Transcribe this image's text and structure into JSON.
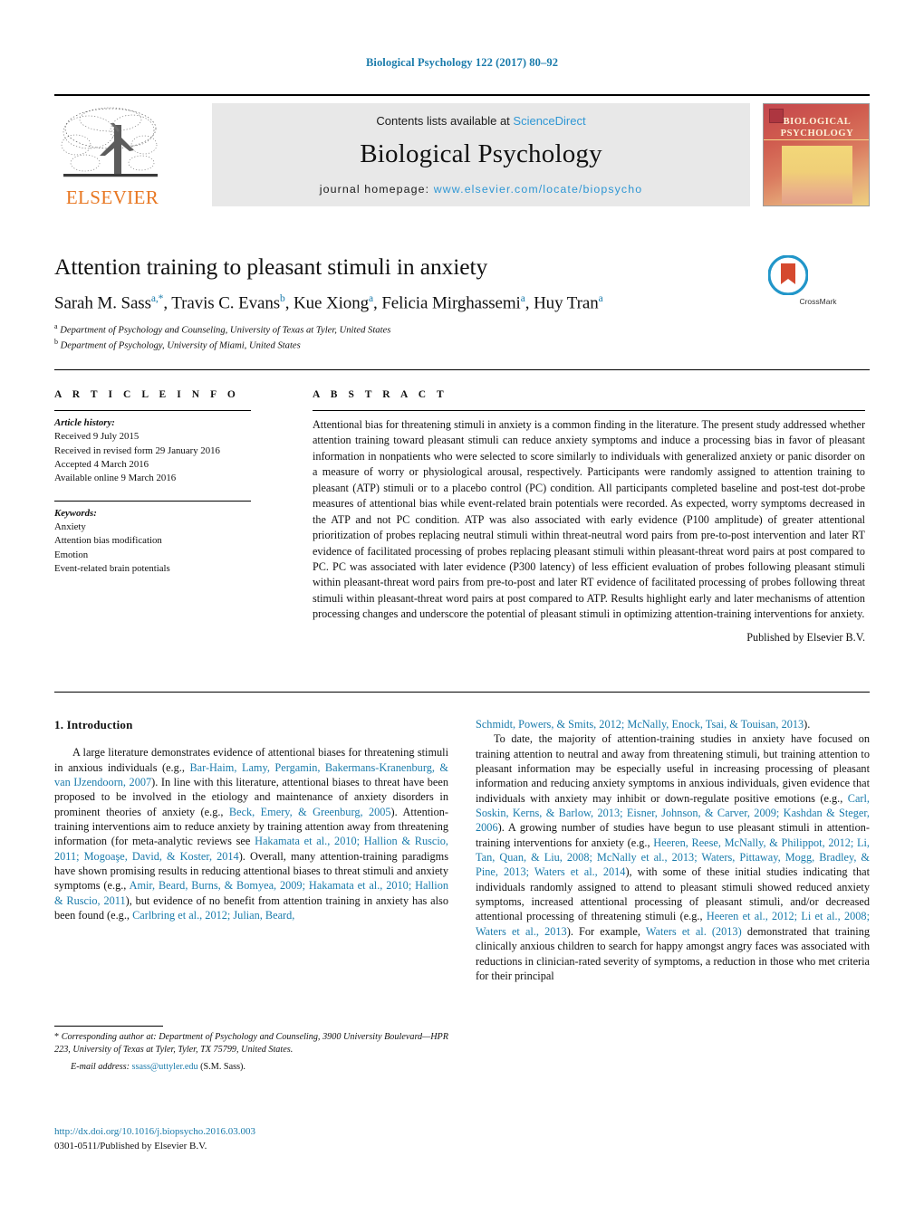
{
  "running_head": "Biological Psychology 122 (2017) 80–92",
  "masthead": {
    "elsevier_wordmark": "ELSEVIER",
    "contents_prefix": "Contents lists available at ",
    "contents_link": "ScienceDirect",
    "journal_title": "Biological Psychology",
    "homepage_prefix": "journal homepage: ",
    "homepage_url": "www.elsevier.com/locate/biopsycho",
    "cover_title_line1": "BIOLOGICAL",
    "cover_title_line2": "PSYCHOLOGY"
  },
  "article": {
    "title": "Attention training to pleasant stimuli in anxiety",
    "authors_html": "Sarah M. Sass<sup>a,*</sup>, Travis C. Evans<sup>b</sup>, Kue Xiong<sup>a</sup>, Felicia Mirghassemi<sup>a</sup>, Huy Tran<sup>a</sup>",
    "affiliation_a": "Department of Psychology and Counseling, University of Texas at Tyler, United States",
    "affiliation_b": "Department of Psychology, University of Miami, United States",
    "crossmark_label": "CrossMark"
  },
  "info": {
    "heading": "A R T I C L E   I N F O",
    "history_label": "Article history:",
    "history": [
      "Received 9 July 2015",
      "Received in revised form 29 January 2016",
      "Accepted 4 March 2016",
      "Available online 9 March 2016"
    ],
    "keywords_label": "Keywords:",
    "keywords": [
      "Anxiety",
      "Attention bias modification",
      "Emotion",
      "Event-related brain potentials"
    ]
  },
  "abstract": {
    "heading": "A B S T R A C T",
    "text": "Attentional bias for threatening stimuli in anxiety is a common finding in the literature. The present study addressed whether attention training toward pleasant stimuli can reduce anxiety symptoms and induce a processing bias in favor of pleasant information in nonpatients who were selected to score similarly to individuals with generalized anxiety or panic disorder on a measure of worry or physiological arousal, respectively. Participants were randomly assigned to attention training to pleasant (ATP) stimuli or to a placebo control (PC) condition. All participants completed baseline and post-test dot-probe measures of attentional bias while event-related brain potentials were recorded. As expected, worry symptoms decreased in the ATP and not PC condition. ATP was also associated with early evidence (P100 amplitude) of greater attentional prioritization of probes replacing neutral stimuli within threat-neutral word pairs from pre-to-post intervention and later RT evidence of facilitated processing of probes replacing pleasant stimuli within pleasant-threat word pairs at post compared to PC. PC was associated with later evidence (P300 latency) of less efficient evaluation of probes following pleasant stimuli within pleasant-threat word pairs from pre-to-post and later RT evidence of facilitated processing of probes following threat stimuli within pleasant-threat word pairs at post compared to ATP. Results highlight early and later mechanisms of attention processing changes and underscore the potential of pleasant stimuli in optimizing attention-training interventions for anxiety.",
    "publisher": "Published by Elsevier B.V."
  },
  "introduction": {
    "heading": "1. Introduction",
    "left_paragraph_html": "A large literature demonstrates evidence of attentional biases for threatening stimuli in anxious individuals (e.g., <span class=\"ref\">Bar-Haim, Lamy, Pergamin, Bakermans-Kranenburg, &amp; van IJzendoorn, 2007</span>). In line with this literature, attentional biases to threat have been proposed to be involved in the etiology and maintenance of anxiety disorders in prominent theories of anxiety (e.g., <span class=\"ref\">Beck, Emery, &amp; Greenburg, 2005</span>). Attention-training interventions aim to reduce anxiety by training attention away from threatening information (for meta-analytic reviews see <span class=\"ref\">Hakamata et al., 2010; Hallion &amp; Ruscio, 2011; Mogoa&#351;e, David, &amp; Koster, 2014</span>). Overall, many attention-training paradigms have shown promising results in reducing attentional biases to threat stimuli and anxiety symptoms (e.g., <span class=\"ref\">Amir, Beard, Burns, &amp; Bomyea, 2009; Hakamata et al., 2010; Hallion &amp; Ruscio, 2011</span>), but evidence of no benefit from attention training in anxiety has also been found (e.g., <span class=\"ref\">Carlbring et al., 2012; Julian, Beard,</span>",
    "right_continuation_html": "<span class=\"ref\">Schmidt, Powers, &amp; Smits, 2012; McNally, Enock, Tsai, &amp; Touisan, 2013</span>).",
    "right_paragraph_html": "To date, the majority of attention-training studies in anxiety have focused on training attention to neutral and away from threatening stimuli, but training attention to pleasant information may be especially useful in increasing processing of pleasant information and reducing anxiety symptoms in anxious individuals, given evidence that individuals with anxiety may inhibit or down-regulate positive emotions (e.g., <span class=\"ref\">Carl, Soskin, Kerns, &amp; Barlow, 2013; Eisner, Johnson, &amp; Carver, 2009; Kashdan &amp; Steger, 2006</span>). A growing number of studies have begun to use pleasant stimuli in attention-training interventions for anxiety (e.g., <span class=\"ref\">Heeren, Reese, McNally, &amp; Philippot, 2012; Li, Tan, Quan, &amp; Liu, 2008; McNally et al., 2013; Waters, Pittaway, Mogg, Bradley, &amp; Pine, 2013; Waters et al., 2014</span>), with some of these initial studies indicating that individuals randomly assigned to attend to pleasant stimuli showed reduced anxiety symptoms, increased attentional processing of pleasant stimuli, and/or decreased attentional processing of threatening stimuli (e.g., <span class=\"ref\">Heeren et al., 2012; Li et al., 2008; Waters et al., 2013</span>). For example, <span class=\"ref\">Waters et al. (2013)</span> demonstrated that training clinically anxious children to search for happy amongst angry faces was associated with reductions in clinician-rated severity of symptoms, a reduction in those who met criteria for their principal"
  },
  "footnote": {
    "corresponding_html": "* <span class=\"it\">Corresponding author at: Department of Psychology and Counseling, 3900 University Boulevard—HPR 223, University of Texas at Tyler, Tyler, TX 75799, United States.</span>",
    "email_label": "E-mail address:",
    "email": "ssass@uttyler.edu",
    "email_owner": "(S.M. Sass)."
  },
  "doi": {
    "url": "http://dx.doi.org/10.1016/j.biopsycho.2016.03.003",
    "issn_line": "0301-0511/Published by Elsevier B.V."
  },
  "colors": {
    "link_blue": "#1a7bab",
    "sciencedirect_blue": "#2f97d4",
    "elsevier_orange": "#E87722",
    "masthead_grey": "#e8e8e8"
  }
}
